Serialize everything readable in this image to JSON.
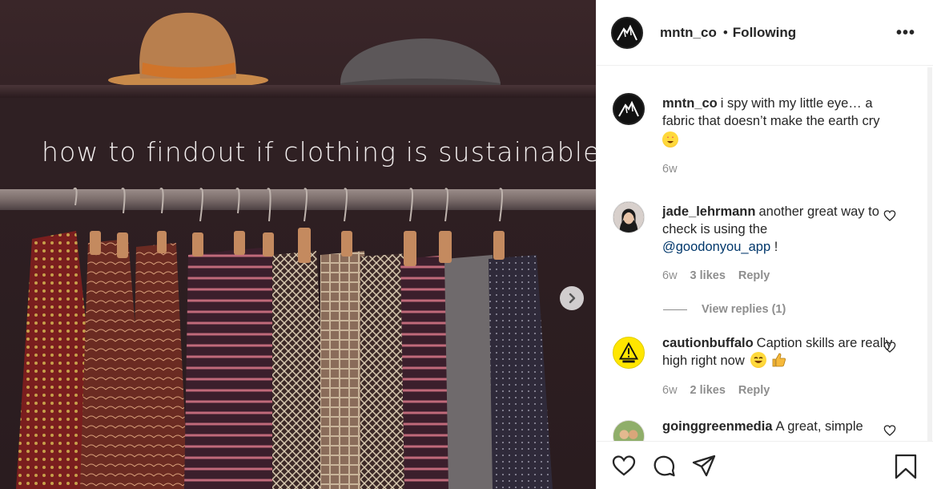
{
  "post": {
    "overlay_text": "how to findout if clothing is sustainable"
  },
  "header": {
    "username": "mntn_co",
    "separator": "•",
    "follow_status": "Following",
    "more_label": "•••"
  },
  "caption": {
    "username": "mntn_co",
    "text": "i spy with my little eye… a fabric that doesn’t make the earth cry",
    "age": "6w"
  },
  "comments": [
    {
      "username": "jade_lehrmann",
      "text": "another great way to check is using the",
      "mention": "@goodonyou_app",
      "suffix": " !",
      "age": "6w",
      "likes": "3 likes",
      "reply": "Reply",
      "view_replies": "View replies (1)"
    },
    {
      "username": "cautionbuffalo",
      "text": "Caption skills are really high right now",
      "age": "6w",
      "likes": "2 likes",
      "reply": "Reply"
    },
    {
      "username": "goinggreenmedia",
      "text": "A great, simple"
    }
  ],
  "icons": {
    "next": "chevron-right-icon",
    "like": "heart-icon",
    "comment": "comment-icon",
    "share": "share-icon",
    "save": "bookmark-icon"
  },
  "colors": {
    "text": "#262626",
    "secondary": "#8e8e8e",
    "mention": "#00376b"
  }
}
